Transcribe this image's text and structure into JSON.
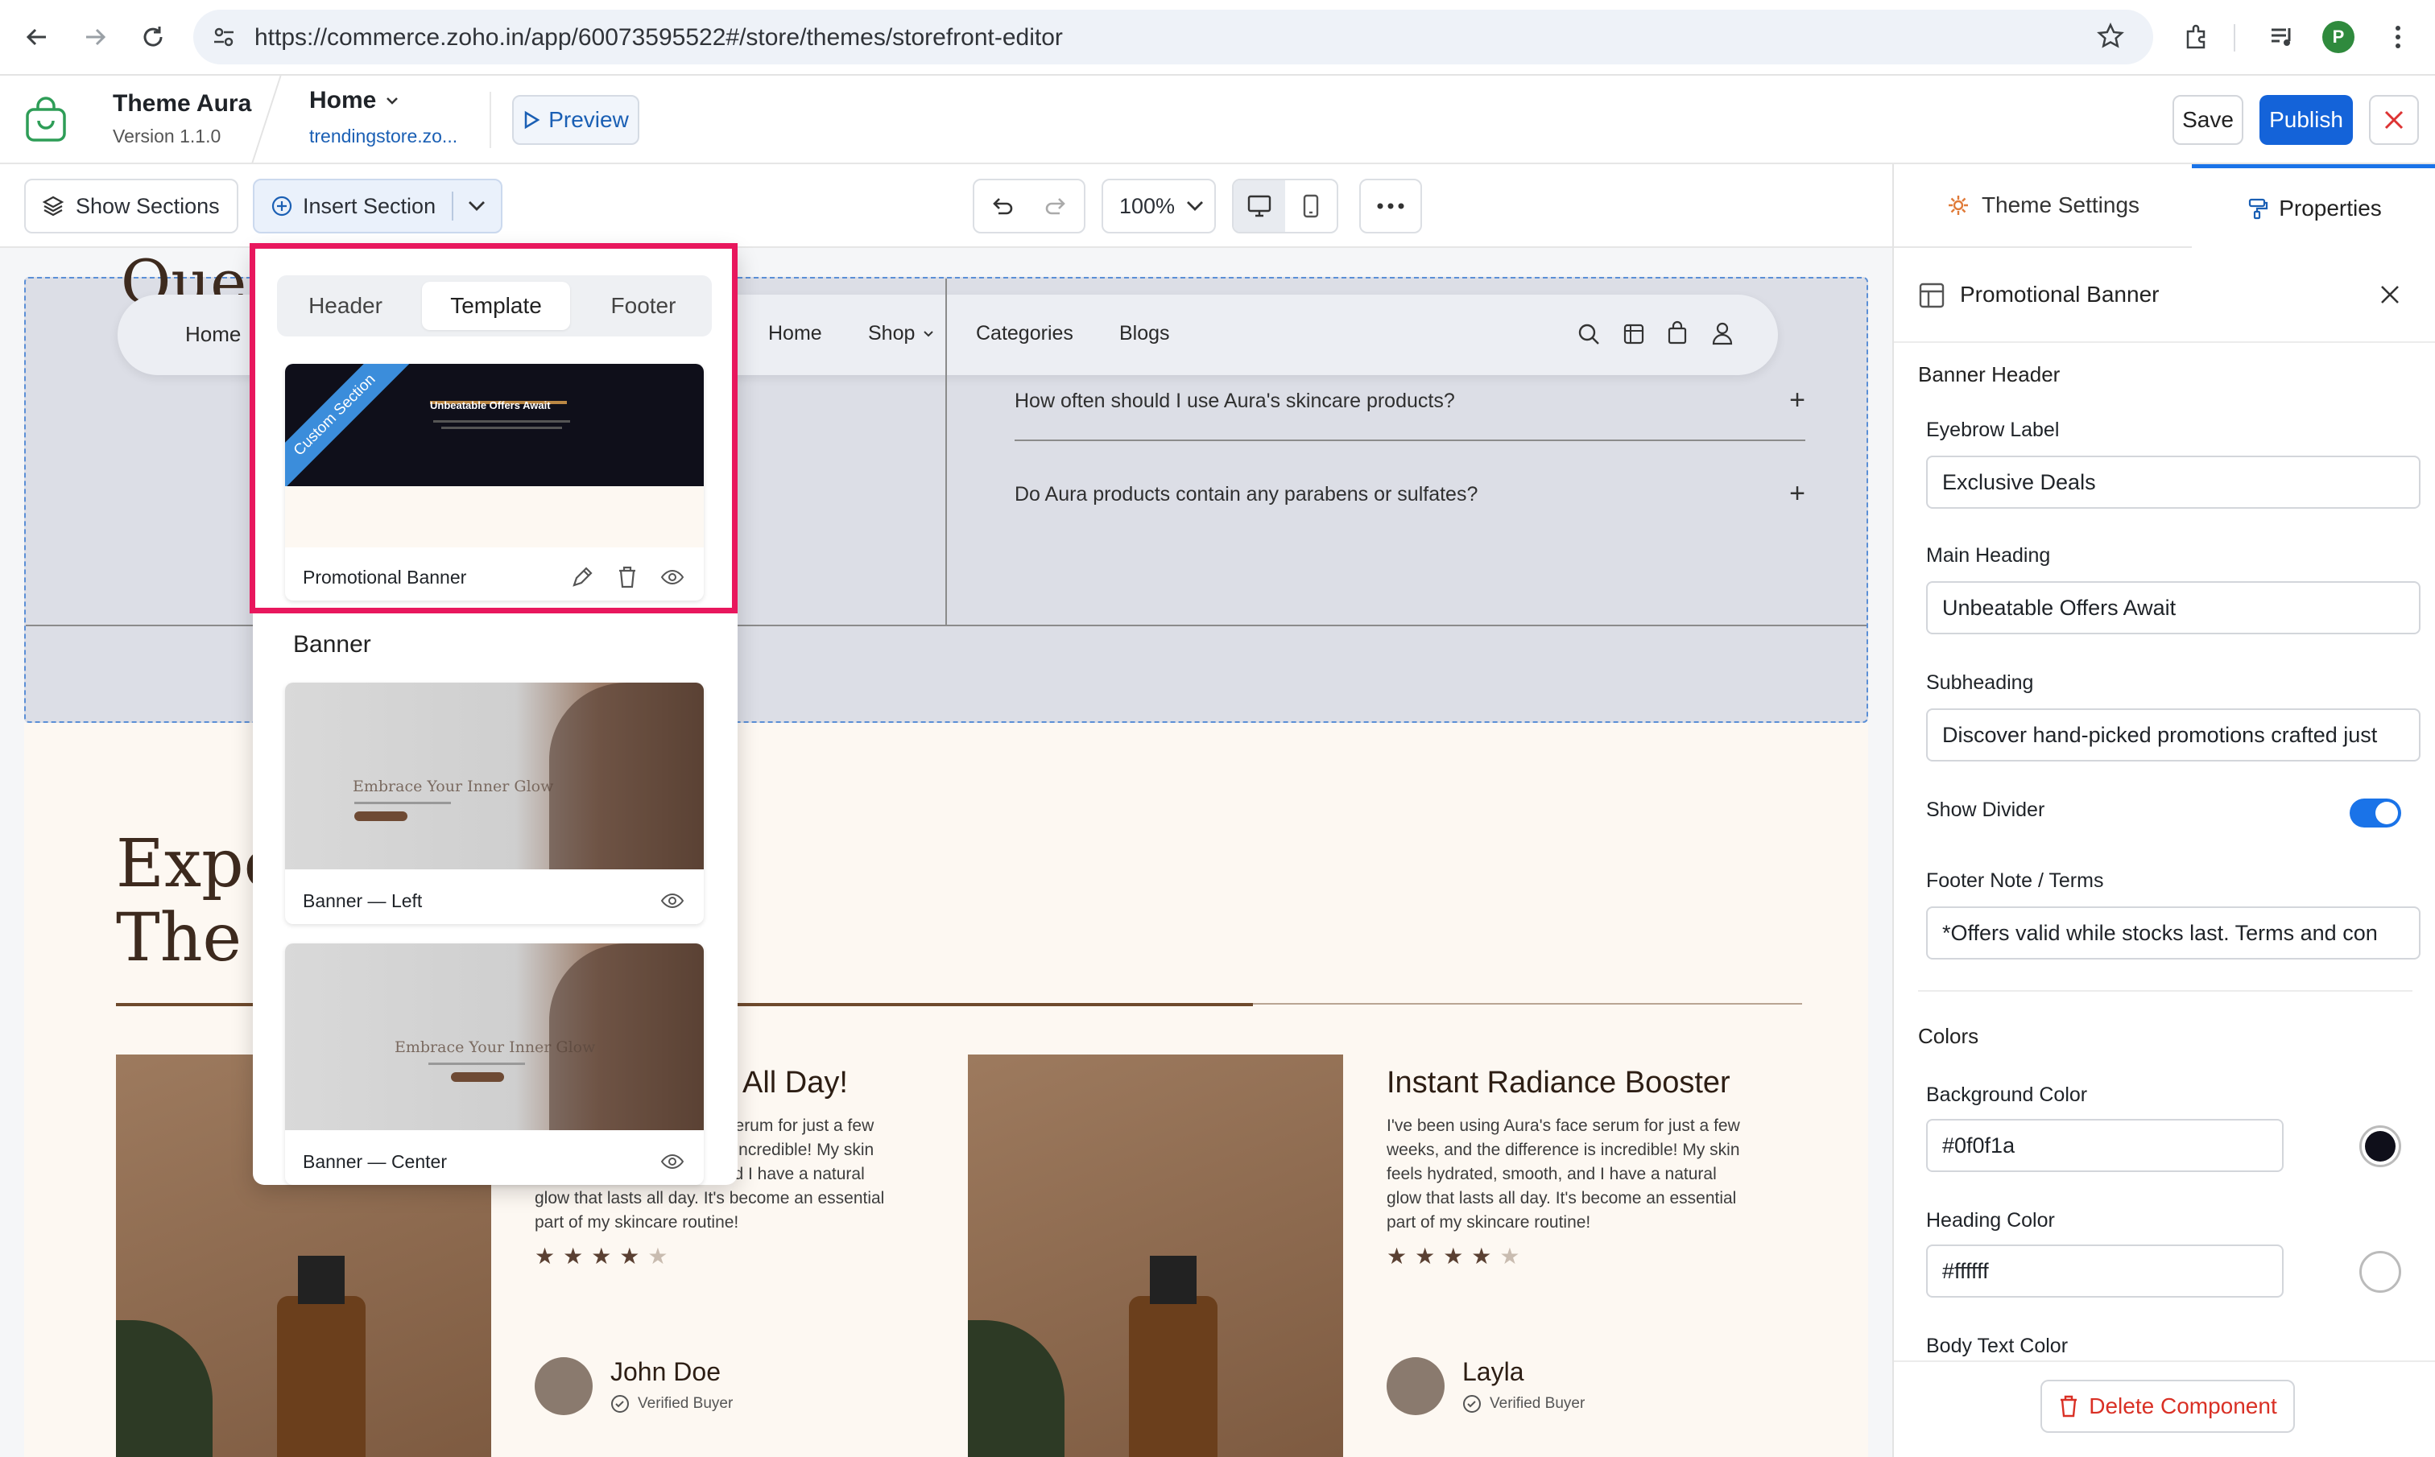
{
  "browser": {
    "url": "https://commerce.zoho.in/app/60073595522#/store/themes/storefront-editor",
    "profile_initial": "P"
  },
  "app": {
    "theme_name": "Theme Aura",
    "version": "Version 1.1.0",
    "page_name": "Home",
    "store_link": "trendingstore.zo...",
    "preview_label": "Preview",
    "save_label": "Save",
    "publish_label": "Publish"
  },
  "toolbar": {
    "show_sections": "Show Sections",
    "insert_section": "Insert Section",
    "zoom": "100%"
  },
  "panel": {
    "tabs": {
      "theme_settings": "Theme Settings",
      "properties": "Properties"
    },
    "component_title": "Promotional Banner",
    "section_header": "Banner Header",
    "eyebrow_label": "Eyebrow Label",
    "eyebrow_value": "Exclusive Deals",
    "main_heading_label": "Main Heading",
    "main_heading_value": "Unbeatable Offers Await",
    "subheading_label": "Subheading",
    "subheading_value": "Discover hand-picked promotions crafted just",
    "show_divider_label": "Show Divider",
    "show_divider_on": true,
    "footer_note_label": "Footer Note / Terms",
    "footer_note_value": "*Offers valid while stocks last. Terms and con",
    "colors_header": "Colors",
    "bg_color_label": "Background Color",
    "bg_color_value": "#0f0f1a",
    "heading_color_label": "Heading Color",
    "heading_color_value": "#ffffff",
    "body_text_color_label": "Body Text Color",
    "delete_label": "Delete Component",
    "accent": "#1a73e8"
  },
  "popup": {
    "tabs": [
      "Header",
      "Template",
      "Footer"
    ],
    "active_tab": "Template",
    "custom_card": {
      "ribbon": "Custom Section",
      "thumb_heading": "Unbeatable Offers Await",
      "label": "Promotional Banner"
    },
    "banner_group_title": "Banner",
    "banner_cards": [
      {
        "label": "Banner — Left",
        "thumb_text": "Embrace Your Inner Glow"
      },
      {
        "label": "Banner — Center",
        "thumb_text": "Embrace Your Inner Glow"
      }
    ]
  },
  "site": {
    "nav_left": "Home",
    "nav": [
      "Home",
      "Shop",
      "Categories",
      "Blogs"
    ],
    "heading_fragment": "Ques",
    "faq": [
      "How often should I use Aura's skincare products?",
      "Do Aura products contain any parabens or sulfates?"
    ],
    "experience_heading_1": "Expe",
    "experience_heading_2": "The C",
    "testimonials": [
      {
        "title_fragment": "All Day!",
        "body_lines": [
          "ce serum for just a few",
          "e is incredible! My skin",
          "feels hydrated, smooth, and I have a natural",
          "glow that lasts all day. It's become an essential",
          "part of my skincare routine!"
        ],
        "rating": 4,
        "name": "John Doe",
        "verified": "Verified Buyer"
      },
      {
        "title": "Instant Radiance Booster",
        "body_lines": [
          "I've been using Aura's face serum for just a few",
          "weeks, and the difference is incredible! My skin",
          "feels hydrated, smooth, and I have a natural",
          "glow that lasts all day. It's become an essential",
          "part of my skincare routine!"
        ],
        "rating": 4,
        "name": "Layla",
        "verified": "Verified Buyer"
      }
    ]
  }
}
